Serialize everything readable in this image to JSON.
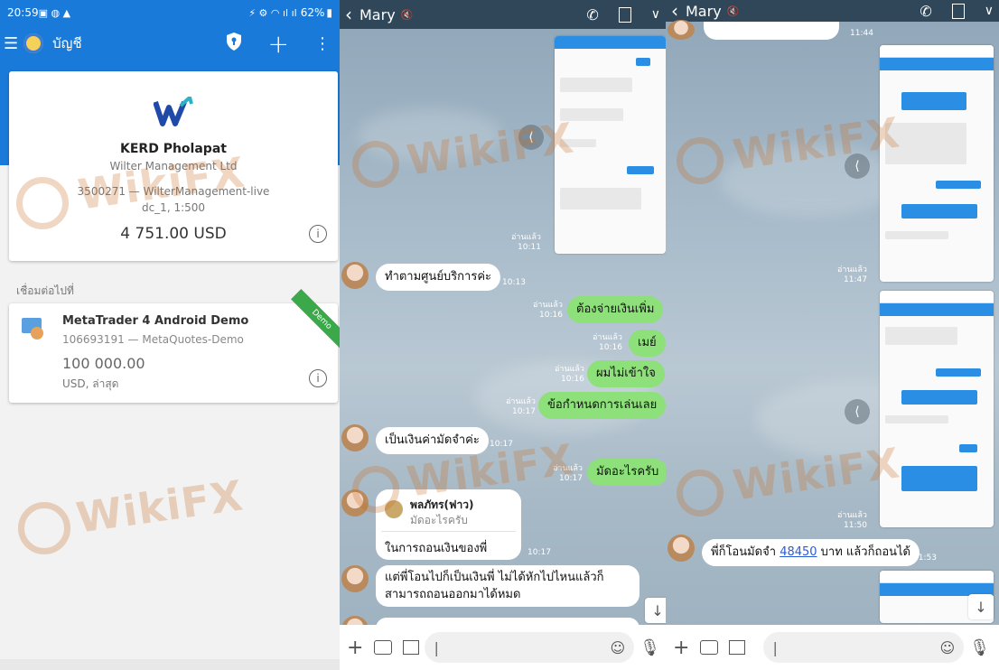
{
  "mt4": {
    "status_time": "20:59",
    "status_battery": "62%",
    "toolbar_title": "บัญชี",
    "account": {
      "name": "KERD Pholapat",
      "company": "Wilter Management Ltd",
      "number_server": "3500271 — WilterManagement-live",
      "group_leverage": "dc_1, 1:500",
      "balance": "4 751.00 USD"
    },
    "connect_label": "เชื่อมต่อไปที่",
    "demo": {
      "name": "MetaTrader 4 Android Demo",
      "number_server": "106693191 — MetaQuotes-Demo",
      "balance": "100 000.00",
      "currency_note": "USD, ล่าสุด",
      "ribbon": "Demo"
    },
    "watermark": "WikiFX"
  },
  "chat1": {
    "name": "Mary",
    "messages": [
      {
        "read": "อ่านแล้ว",
        "time": "10:11"
      },
      {
        "text": "ทำตามศูนย์บริการค่ะ",
        "time": "10:13"
      },
      {
        "text": "ต้องจ่ายเงินเพิ่ม",
        "read": "อ่านแล้ว",
        "time": "10:16"
      },
      {
        "text": "เมย์",
        "read": "อ่านแล้ว",
        "time": "10:16"
      },
      {
        "text": "ผมไม่เข้าใจ",
        "read": "อ่านแล้ว",
        "time": "10:16"
      },
      {
        "text": "ข้อกำหนดการเล่นเลย",
        "read": "อ่านแล้ว",
        "time": "10:17"
      },
      {
        "text": "เป็นเงินค่ามัดจำค่ะ",
        "time": "10:17"
      },
      {
        "text": "มัดอะไรครับ",
        "read": "อ่านแล้ว",
        "time": "10:17"
      },
      {
        "reply_name": "พลภัทร(ฟาว)",
        "reply_quote": "มัดอะไรครับ",
        "text": "ในการถอนเงินของพี่",
        "time": "10:17"
      },
      {
        "text1": "แต่พี่โอนไปก็เป็นเงินพี่ ไม่ได้หักไปไหนแล้วก็",
        "text2": "สามารถถอนออกมาได้หมด"
      }
    ]
  },
  "chat2": {
    "name": "Mary",
    "times": {
      "t1": "11:44",
      "t2": "11:47",
      "t3": "11:50",
      "t4": "11:53"
    },
    "read": "อ่านแล้ว",
    "last_msg_a": "พี่ก็โอนมัดจำ ",
    "last_msg_amount": "48450",
    "last_msg_b": " บาท แล้วก็ถอนได้"
  }
}
